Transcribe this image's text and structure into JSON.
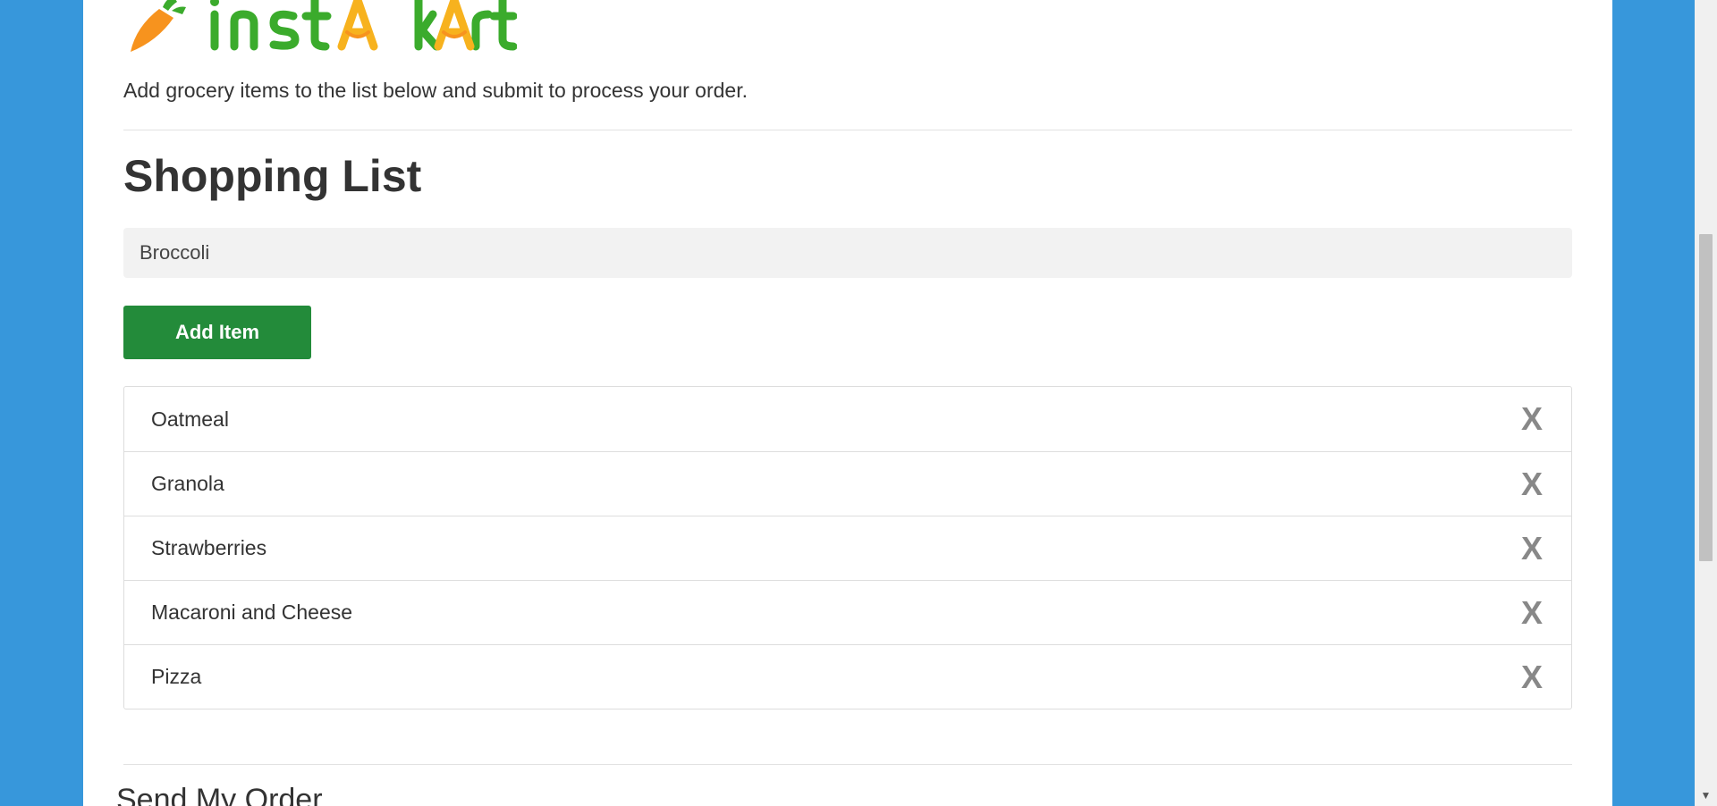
{
  "header": {
    "logo_text": "instAkArt",
    "subtitle": "Add grocery items to the list below and submit to process your order."
  },
  "shopping_list": {
    "title": "Shopping List",
    "input_value": "Broccoli",
    "add_button_label": "Add Item",
    "items": [
      {
        "label": "Oatmeal",
        "remove_label": "X"
      },
      {
        "label": "Granola",
        "remove_label": "X"
      },
      {
        "label": "Strawberries",
        "remove_label": "X"
      },
      {
        "label": "Macaroni and Cheese",
        "remove_label": "X"
      },
      {
        "label": "Pizza",
        "remove_label": "X"
      }
    ]
  },
  "order_section": {
    "title": "Send My Order"
  },
  "scrollbar": {
    "down_arrow": "▼"
  },
  "colors": {
    "background": "#3797db",
    "accent_green": "#238b3a",
    "logo_green": "#3bab2c",
    "logo_orange": "#f7931e"
  }
}
